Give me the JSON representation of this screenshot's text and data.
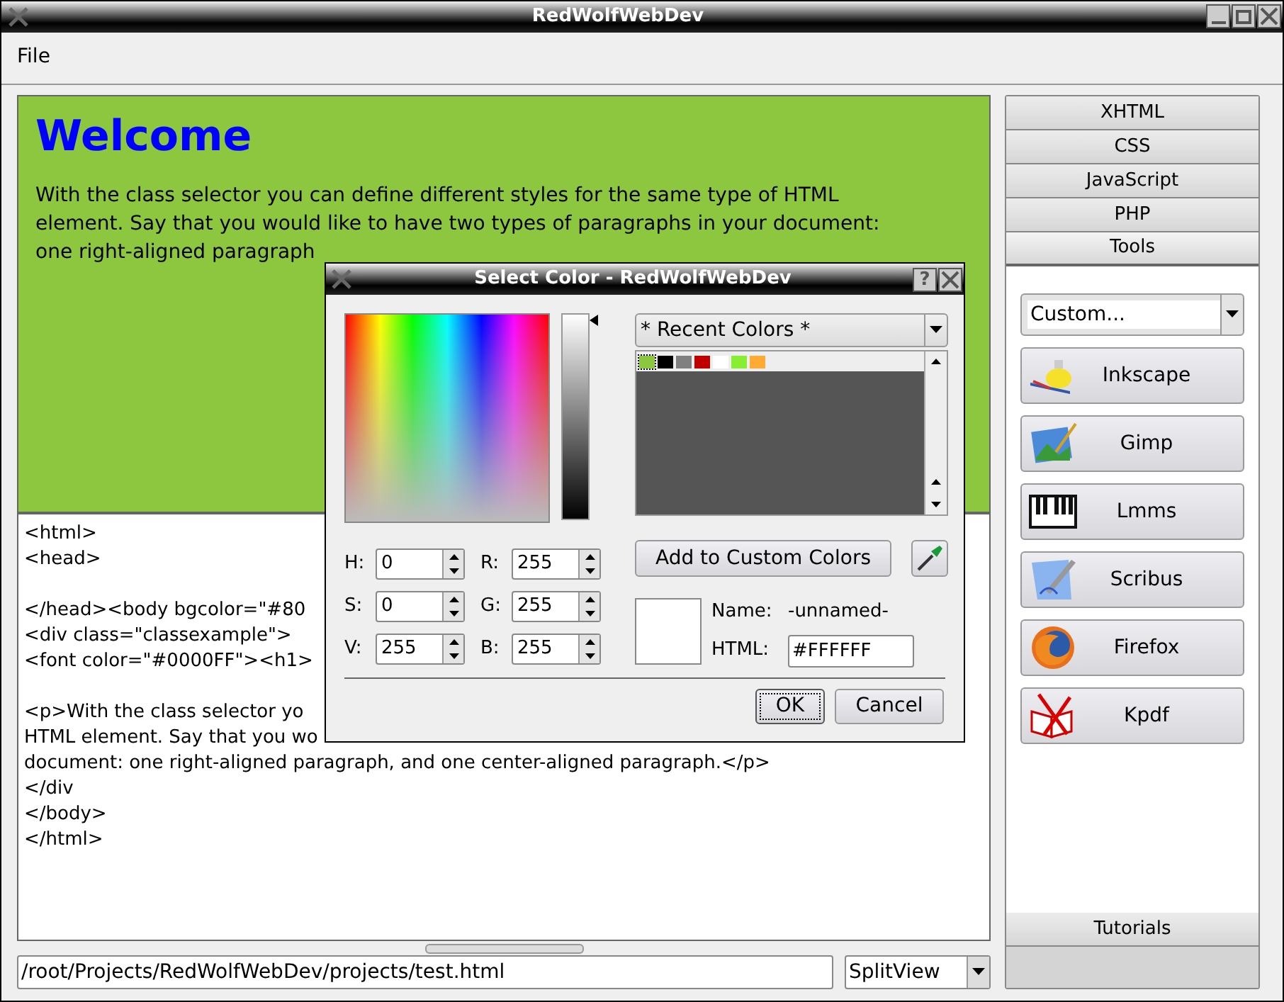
{
  "window": {
    "title": "RedWolfWebDev"
  },
  "menu": [
    "File"
  ],
  "preview": {
    "heading": "Welcome",
    "lines": [
      "With the class selector you can define different styles for the same type of HTML",
      "element. Say that you would like to have two types of paragraphs in your document:",
      "one right-aligned paragraph"
    ]
  },
  "code_blocks": [
    [
      "<html>",
      "<head>"
    ],
    [
      "</head><body bgcolor=\"#80",
      "<div class=\"classexample\">",
      "<font color=\"#0000FF\"><h1>"
    ],
    [
      "<p>With the class selector yo",
      "HTML element. Say that you wo",
      "document: one right-aligned paragraph, and one center-aligned paragraph.</p>",
      "</div",
      "</body>",
      "</html>"
    ]
  ],
  "path_field": {
    "value": "/root/Projects/RedWolfWebDev/projects/test.html"
  },
  "view_select": {
    "value": "SplitView"
  },
  "sidebar": {
    "tabs": [
      {
        "label": "XHTML",
        "selected": false
      },
      {
        "label": "CSS",
        "selected": false
      },
      {
        "label": "JavaScript",
        "selected": false
      },
      {
        "label": "PHP",
        "selected": false
      },
      {
        "label": "Tools",
        "selected": true
      }
    ],
    "tool_select": {
      "value": "Custom..."
    },
    "tools": [
      "Inkscape",
      "Gimp",
      "Lmms",
      "Scribus",
      "Firefox",
      "Kpdf"
    ],
    "bottom_tabs": [
      {
        "label": "Tutorials",
        "selected": false
      }
    ]
  },
  "dialog": {
    "title": "Select Color - RedWolfWebDev",
    "help": "?",
    "palette_select": {
      "value": "* Recent Colors *"
    },
    "recent_colors": [
      {
        "color": "#8dc63f",
        "selected": true
      },
      {
        "color": "#000000",
        "selected": false
      },
      {
        "color": "#808080",
        "selected": false
      },
      {
        "color": "#c00000",
        "selected": false
      },
      {
        "color": "#ffffff",
        "selected": false
      },
      {
        "color": "#88ee33",
        "selected": false
      },
      {
        "color": "#ffaa33",
        "selected": false
      }
    ],
    "fields_left": [
      {
        "label": "H:",
        "value": "0"
      },
      {
        "label": "S:",
        "value": "0"
      },
      {
        "label": "V:",
        "value": "255"
      }
    ],
    "fields_right": [
      {
        "label": "R:",
        "value": "255"
      },
      {
        "label": "G:",
        "value": "255"
      },
      {
        "label": "B:",
        "value": "255"
      }
    ],
    "add_button": "Add to Custom Colors",
    "value_slider": {
      "level": 1
    },
    "name_label": "Name:",
    "name_value": "-unnamed-",
    "html_label": "HTML:",
    "html_value": "#FFFFFF",
    "buttons": [
      {
        "label": "OK",
        "default": true
      },
      {
        "label": "Cancel",
        "default": false
      }
    ]
  }
}
